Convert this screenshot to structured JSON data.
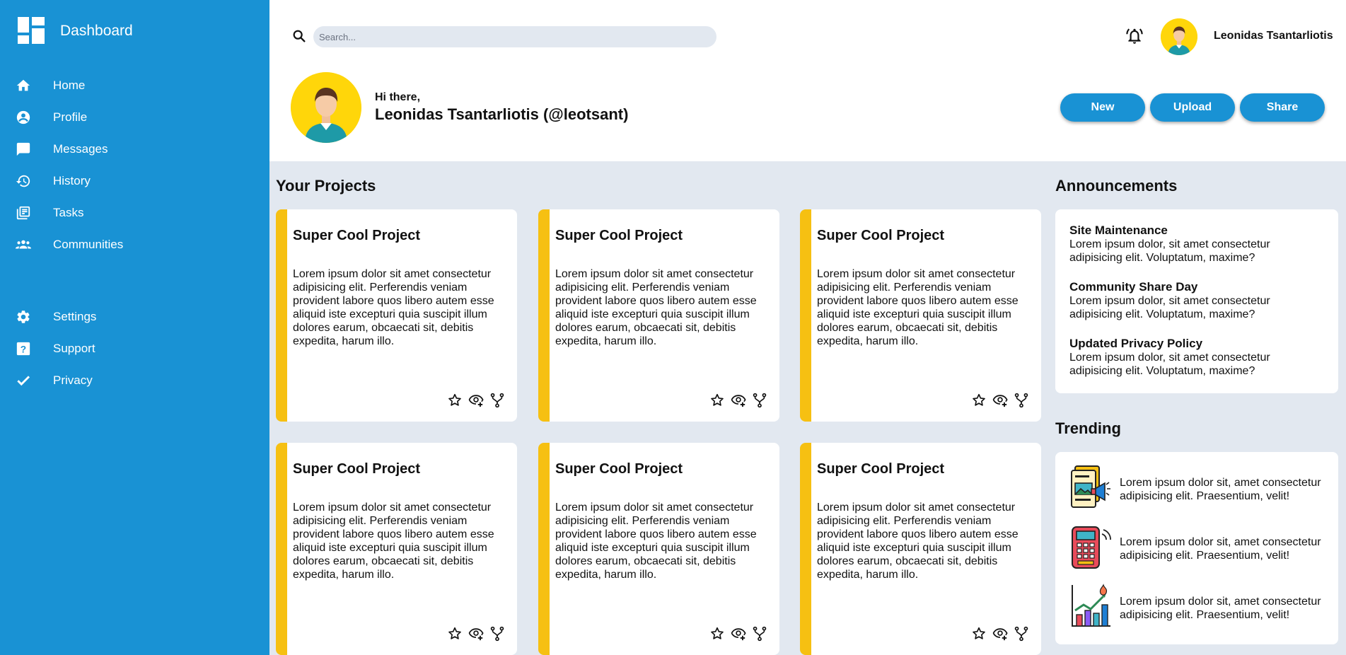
{
  "sidebar": {
    "brand": "Dashboard",
    "nav": [
      {
        "label": "Home",
        "icon": "home-icon"
      },
      {
        "label": "Profile",
        "icon": "account-circle-icon"
      },
      {
        "label": "Messages",
        "icon": "message-icon"
      },
      {
        "label": "History",
        "icon": "history-icon"
      },
      {
        "label": "Tasks",
        "icon": "tasks-icon"
      },
      {
        "label": "Communities",
        "icon": "communities-icon"
      }
    ],
    "nav2": [
      {
        "label": "Settings",
        "icon": "gear-icon"
      },
      {
        "label": "Support",
        "icon": "help-icon"
      },
      {
        "label": "Privacy",
        "icon": "check-icon"
      }
    ]
  },
  "header": {
    "search_placeholder": "Search...",
    "user_name": "Leonidas Tsantarliotis",
    "greeting": "Hi there,",
    "greeting_name": "Leonidas Tsantarliotis (@leotsant)",
    "buttons": [
      "New",
      "Upload",
      "Share"
    ]
  },
  "projects": {
    "title": "Your Projects",
    "cards": [
      {
        "title": "Super Cool Project",
        "text": "Lorem ipsum dolor sit amet consectetur adipisicing elit. Perferendis veniam provident labore quos libero autem esse aliquid iste excepturi quia suscipit illum dolores earum, obcaecati sit, debitis expedita, harum illo."
      },
      {
        "title": "Super Cool Project",
        "text": "Lorem ipsum dolor sit amet consectetur adipisicing elit. Perferendis veniam provident labore quos libero autem esse aliquid iste excepturi quia suscipit illum dolores earum, obcaecati sit, debitis expedita, harum illo."
      },
      {
        "title": "Super Cool Project",
        "text": "Lorem ipsum dolor sit amet consectetur adipisicing elit. Perferendis veniam provident labore quos libero autem esse aliquid iste excepturi quia suscipit illum dolores earum, obcaecati sit, debitis expedita, harum illo."
      },
      {
        "title": "Super Cool Project",
        "text": "Lorem ipsum dolor sit amet consectetur adipisicing elit. Perferendis veniam provident labore quos libero autem esse aliquid iste excepturi quia suscipit illum dolores earum, obcaecati sit, debitis expedita, harum illo."
      },
      {
        "title": "Super Cool Project",
        "text": "Lorem ipsum dolor sit amet consectetur adipisicing elit. Perferendis veniam provident labore quos libero autem esse aliquid iste excepturi quia suscipit illum dolores earum, obcaecati sit, debitis expedita, harum illo."
      },
      {
        "title": "Super Cool Project",
        "text": "Lorem ipsum dolor sit amet consectetur adipisicing elit. Perferendis veniam provident labore quos libero autem esse aliquid iste excepturi quia suscipit illum dolores earum, obcaecati sit, debitis expedita, harum illo."
      }
    ]
  },
  "announcements": {
    "title": "Announcements",
    "items": [
      {
        "title": "Site Maintenance",
        "text": "Lorem ipsum dolor, sit amet consectetur adipisicing elit. Voluptatum, maxime?"
      },
      {
        "title": "Community Share Day",
        "text": "Lorem ipsum dolor, sit amet consectetur adipisicing elit. Voluptatum, maxime?"
      },
      {
        "title": "Updated Privacy Policy",
        "text": "Lorem ipsum dolor, sit amet consectetur adipisicing elit. Voluptatum, maxime?"
      }
    ]
  },
  "trending": {
    "title": "Trending",
    "items": [
      {
        "text": "Lorem ipsum dolor sit, amet consectetur adipisicing elit. Praesentium, velit!",
        "icon": "marketing-icon"
      },
      {
        "text": "Lorem ipsum dolor sit, amet consectetur adipisicing elit. Praesentium, velit!",
        "icon": "payment-terminal-icon"
      },
      {
        "text": "Lorem ipsum dolor sit, amet consectetur adipisicing elit. Praesentium, velit!",
        "icon": "growth-chart-icon"
      }
    ]
  },
  "colors": {
    "sidebar": "#1992d4",
    "accent": "#f6c012",
    "avatar_bg": "#ffd60a",
    "background": "#e2e8f0"
  }
}
